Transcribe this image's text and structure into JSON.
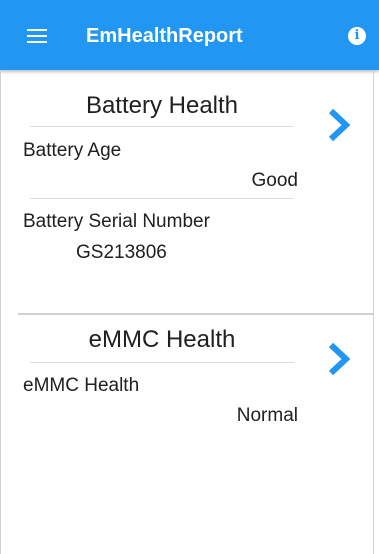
{
  "app_bar": {
    "title": "EmHealthReport",
    "menu_icon": "hamburger-menu-icon",
    "info_icon": "info-icon",
    "info_glyph": "i",
    "color": "#2196f3"
  },
  "battery_card": {
    "title": "Battery Health",
    "chevron_icon": "chevron-right-icon",
    "age_label": "Battery Age",
    "age_value": "Good",
    "serial_label": "Battery Serial Number",
    "serial_value": "GS213806"
  },
  "emmc_card": {
    "title": "eMMC Health",
    "chevron_icon": "chevron-right-icon",
    "health_label": "eMMC Health",
    "health_value": "Normal"
  }
}
